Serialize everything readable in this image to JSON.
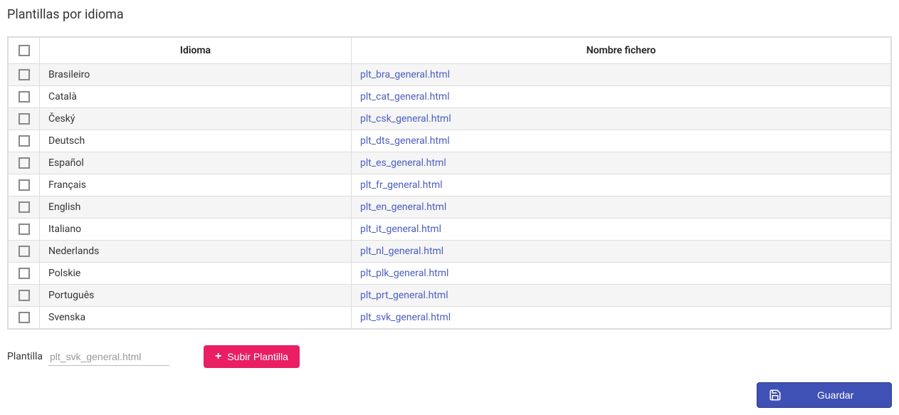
{
  "page_title": "Plantillas por idioma",
  "table": {
    "headers": {
      "idioma": "Idioma",
      "fichero": "Nombre fichero"
    },
    "rows": [
      {
        "idioma": "Brasileiro",
        "fichero": "plt_bra_general.html"
      },
      {
        "idioma": "Català",
        "fichero": "plt_cat_general.html"
      },
      {
        "idioma": "Český",
        "fichero": "plt_csk_general.html"
      },
      {
        "idioma": "Deutsch",
        "fichero": "plt_dts_general.html"
      },
      {
        "idioma": "Español",
        "fichero": "plt_es_general.html"
      },
      {
        "idioma": "Français",
        "fichero": "plt_fr_general.html"
      },
      {
        "idioma": "English",
        "fichero": "plt_en_general.html"
      },
      {
        "idioma": "Italiano",
        "fichero": "plt_it_general.html"
      },
      {
        "idioma": "Nederlands",
        "fichero": "plt_nl_general.html"
      },
      {
        "idioma": "Polskie",
        "fichero": "plt_plk_general.html"
      },
      {
        "idioma": "Português",
        "fichero": "plt_prt_general.html"
      },
      {
        "idioma": "Svenska",
        "fichero": "plt_svk_general.html"
      }
    ]
  },
  "footer": {
    "plantilla_label": "Plantilla",
    "plantilla_value": "plt_svk_general.html",
    "upload_label": "Subir Plantilla",
    "save_label": "Guardar"
  }
}
